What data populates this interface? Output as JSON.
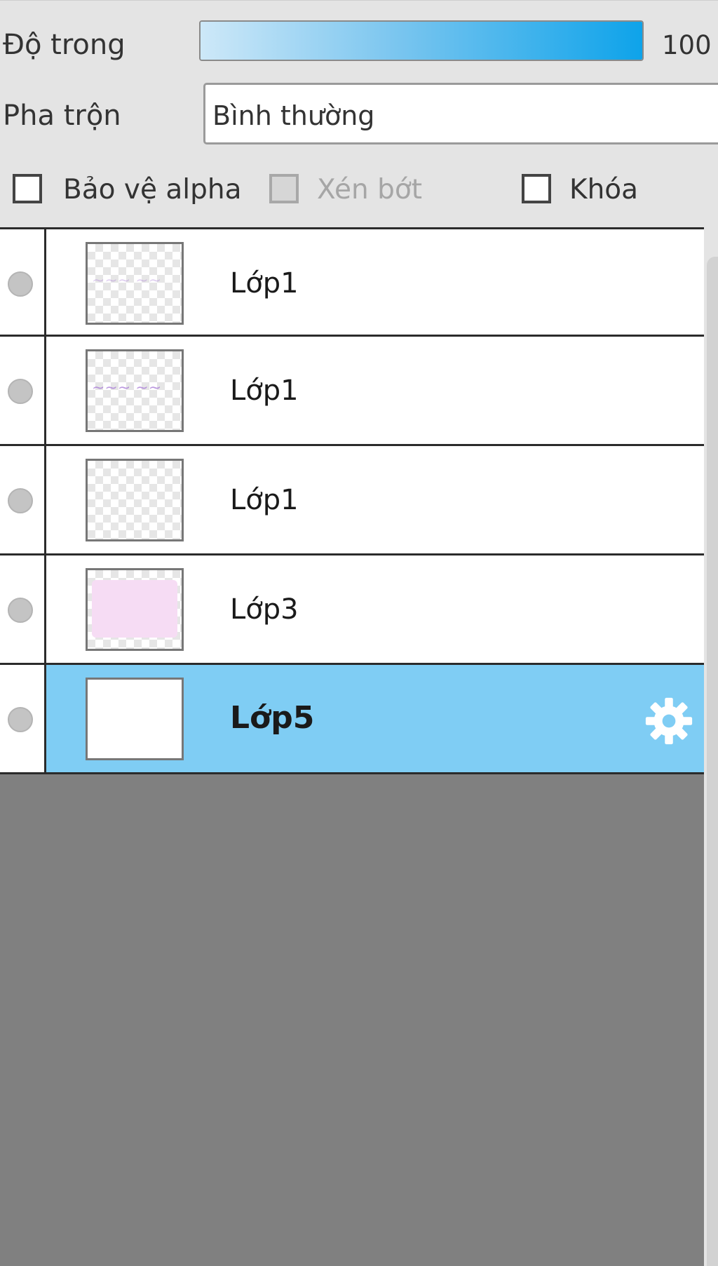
{
  "properties": {
    "opacity_label": "Độ trong",
    "opacity_value": "100",
    "opacity_fraction": 1.0,
    "blend_label": "Pha trộn",
    "blend_mode": "Bình thường",
    "checkboxes": [
      {
        "label": "Bảo vệ alpha",
        "checked": false,
        "enabled": true
      },
      {
        "label": "Xén bớt",
        "checked": false,
        "enabled": false
      },
      {
        "label": "Khóa",
        "checked": false,
        "enabled": true
      }
    ]
  },
  "layers": [
    {
      "name": "Lớp1",
      "thumbnail": "faint-handwriting",
      "selected": false
    },
    {
      "name": "Lớp1",
      "thumbnail": "purple-handwriting",
      "selected": false
    },
    {
      "name": "Lớp1",
      "thumbnail": "transparent",
      "selected": false
    },
    {
      "name": "Lớp3",
      "thumbnail": "pink-fill",
      "selected": false
    },
    {
      "name": "Lớp5",
      "thumbnail": "white",
      "selected": true
    }
  ],
  "colors": {
    "selection": "#7fcdf4",
    "slider_end": "#0ea3ea",
    "empty_area": "#808080"
  },
  "icons": {
    "layer_settings": "gear-icon",
    "visibility": "visibility-dot-icon"
  }
}
